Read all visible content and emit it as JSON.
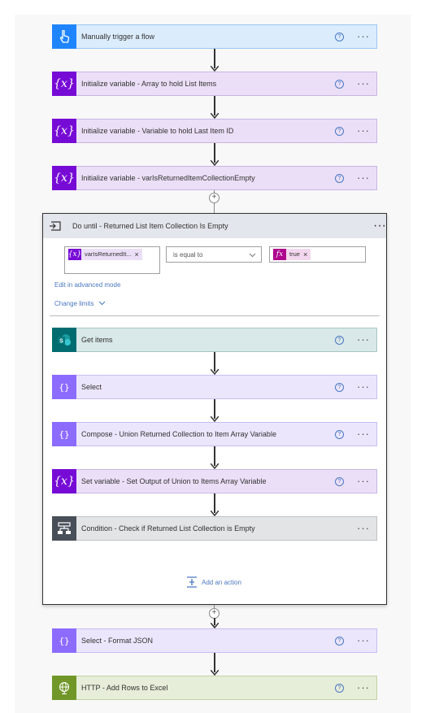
{
  "steps_top": [
    {
      "title": "Manually trigger a flow"
    },
    {
      "title": "Initialize variable - Array to hold List Items"
    },
    {
      "title": "Initialize variable - Variable to hold Last Item ID"
    },
    {
      "title": "Initialize variable - varIsReturnedItemCollectionEmpty"
    }
  ],
  "loop": {
    "title": "Do until - Returned List Item Collection Is Empty",
    "condition": {
      "left_token": "varIsReturnedIt...",
      "operator": "is equal to",
      "right_token": "true"
    },
    "edit_advanced": "Edit in advanced mode",
    "change_limits": "Change limits",
    "steps": [
      {
        "title": "Get items"
      },
      {
        "title": "Select"
      },
      {
        "title": "Compose - Union Returned Collection to Item Array Variable"
      },
      {
        "title": "Set variable - Set Output of Union to Items Array Variable"
      },
      {
        "title": "Condition - Check if Returned List Collection is Empty"
      }
    ],
    "add_action": "Add an action"
  },
  "steps_bottom": [
    {
      "title": "Select - Format JSON"
    },
    {
      "title": "HTTP - Add Rows to Excel"
    }
  ],
  "ui": {
    "help": "?",
    "more": "···",
    "remove": "×",
    "plus": "+",
    "fx": "fx",
    "caret": "⌄"
  },
  "colors": {
    "trigger": "#1f85ff",
    "variable": "#770bd6",
    "data_op": "#8c6cff",
    "sharepoint": "#036c70",
    "control": "#484f58",
    "http": "#709727",
    "expression": "#ad008c",
    "link": "#4a78c2"
  }
}
